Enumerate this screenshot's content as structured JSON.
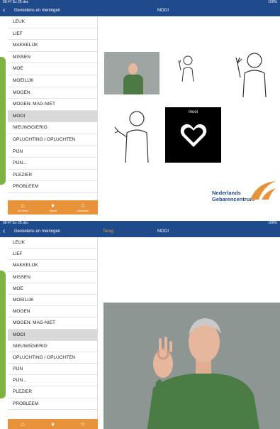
{
  "screen1": {
    "status": {
      "time": "09:47  Ez 25 dec",
      "right": "100%"
    },
    "nav": {
      "back_icon": "chevron-left-icon",
      "title": "Gevoelens en meningen",
      "center": "MOOI"
    },
    "items": [
      {
        "label": "LEUK"
      },
      {
        "label": "LIEF"
      },
      {
        "label": "MAKKELIJK"
      },
      {
        "label": "MISSEN"
      },
      {
        "label": "MOE"
      },
      {
        "label": "MOEILIJK"
      },
      {
        "label": "MOGEN"
      },
      {
        "label": "MOGEN: MAG-NIET"
      },
      {
        "label": "MOOI",
        "selected": true
      },
      {
        "label": "NIEUWSGIERIG"
      },
      {
        "label": "OPLUCHTING / OPLUCHTEN"
      },
      {
        "label": "PIJN"
      },
      {
        "label": "PIJN..."
      },
      {
        "label": "PLEZIER"
      },
      {
        "label": "PROBLEEM"
      }
    ],
    "tabs": [
      {
        "icon": "gift-icon",
        "label": "Alle items"
      },
      {
        "icon": "pin-icon",
        "label": "Thema"
      },
      {
        "icon": "star-icon",
        "label": "Favorieten"
      }
    ],
    "heart_tile_label": "mooi",
    "logo": {
      "line1": "Nederlands",
      "line2": "Gebarencentrum"
    }
  },
  "screen2": {
    "status": {
      "time": "09:47  Ez 25 dec",
      "right": "100%"
    },
    "nav": {
      "back_icon": "chevron-left-icon",
      "title": "Gevoelens en meningen",
      "terug": "Terug",
      "center": "MOOI"
    },
    "items": [
      {
        "label": "LEUK"
      },
      {
        "label": "LIEF"
      },
      {
        "label": "MAKKELIJK"
      },
      {
        "label": "MISSEN"
      },
      {
        "label": "MOE"
      },
      {
        "label": "MOEILIJK"
      },
      {
        "label": "MOGEN"
      },
      {
        "label": "MOGEN: MAG-NIET"
      },
      {
        "label": "MOOI",
        "selected": true
      },
      {
        "label": "NIEUWSGIERIG"
      },
      {
        "label": "OPLUCHTING / OPLUCHTEN"
      },
      {
        "label": "PIJN"
      },
      {
        "label": "PIJN..."
      },
      {
        "label": "PLEZIER"
      },
      {
        "label": "PROBLEEM"
      }
    ],
    "tabs": [
      {
        "icon": "gift-icon"
      },
      {
        "icon": "pin-icon"
      },
      {
        "icon": "star-icon"
      }
    ]
  },
  "colors": {
    "navbar": "#1f4a8c",
    "tabbar": "#e8933a",
    "selected": "#d9d9d9",
    "green_edge": "#7cb342",
    "logo_orange": "#e8933a"
  }
}
